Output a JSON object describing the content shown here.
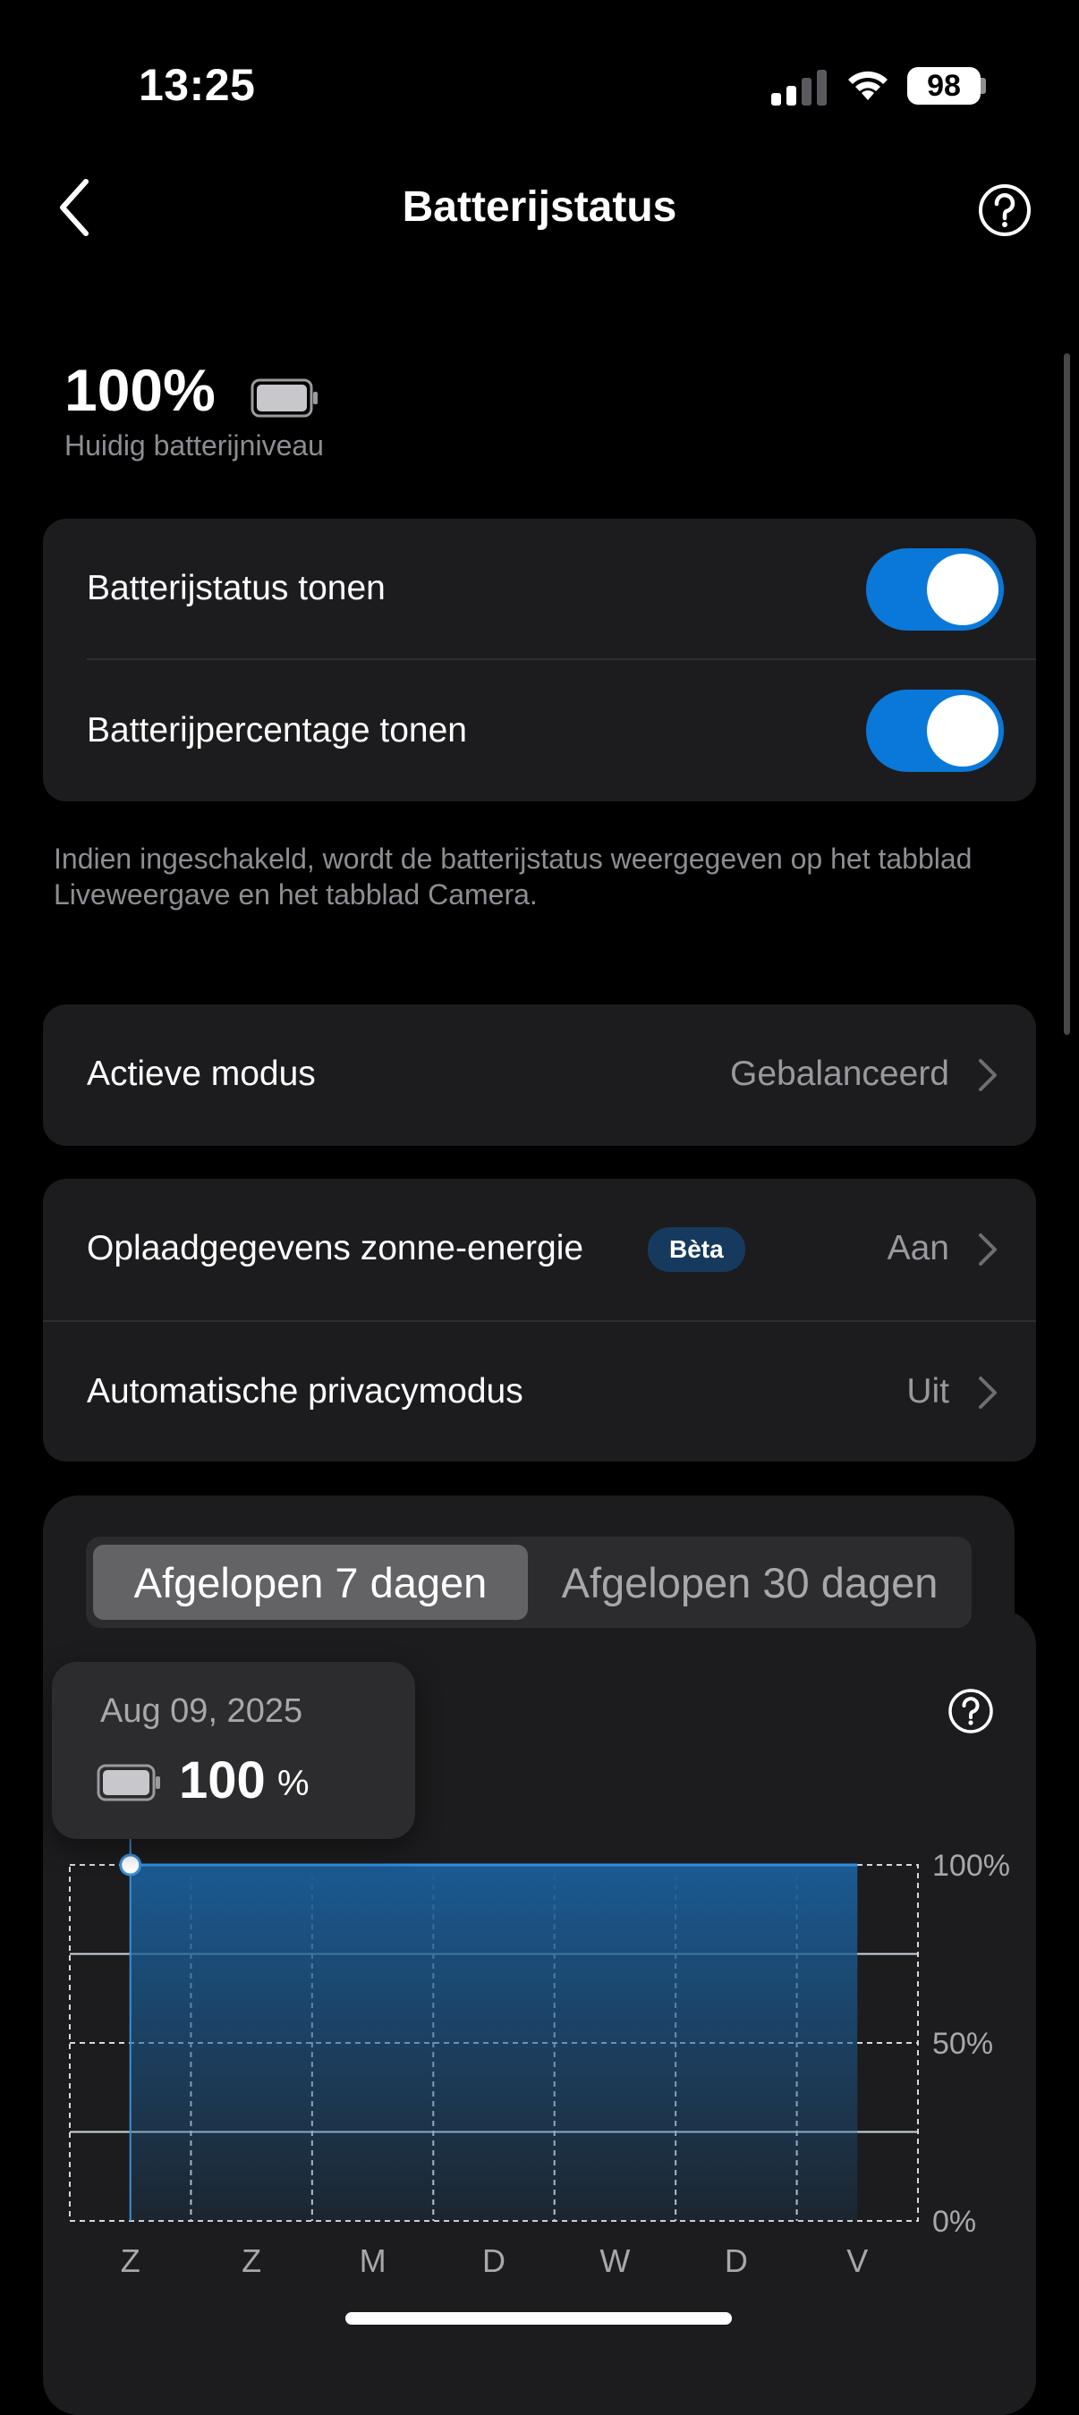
{
  "status_bar": {
    "time": "13:25",
    "battery": "98"
  },
  "nav": {
    "title": "Batterijstatus",
    "back_icon": "chevron-left-icon",
    "help_icon": "question-circle-icon"
  },
  "battery": {
    "level": "100%",
    "caption": "Huidig batterijniveau"
  },
  "display_settings": {
    "rows": [
      {
        "label": "Batterijstatus tonen",
        "enabled": true
      },
      {
        "label": "Batterijpercentage tonen",
        "enabled": true
      }
    ],
    "footnote": "Indien ingeschakeld, wordt de batterijstatus weergegeven op het tabblad Liveweergave en het tabblad Camera."
  },
  "mode": {
    "label": "Actieve modus",
    "value": "Gebalanceerd"
  },
  "extras": {
    "solar_label": "Oplaadgegevens zonne-energie",
    "solar_badge": "Bèta",
    "solar_value": "Aan",
    "privacy_label": "Automatische privacymodus",
    "privacy_value": "Uit"
  },
  "history": {
    "tabs": [
      "Afgelopen 7 dagen",
      "Afgelopen 30 dagen"
    ],
    "active_tab": "Afgelopen 7 dagen",
    "tooltip": {
      "date": "Aug 09, 2025",
      "value": "100",
      "unit": "%"
    }
  },
  "colors": {
    "accent": "#0a78d9",
    "card": "#1c1c1e",
    "chart_fill": "#1b4f7e",
    "chart_line": "#2f8fe0"
  },
  "chart_data": {
    "type": "area",
    "categories": [
      "Z",
      "Z",
      "M",
      "D",
      "W",
      "D",
      "V"
    ],
    "values": [
      100,
      100,
      100,
      100,
      100,
      100,
      100
    ],
    "y_ticks": [
      "100%",
      "50%",
      "0%"
    ],
    "ylim": [
      0,
      100
    ],
    "grid": true
  }
}
